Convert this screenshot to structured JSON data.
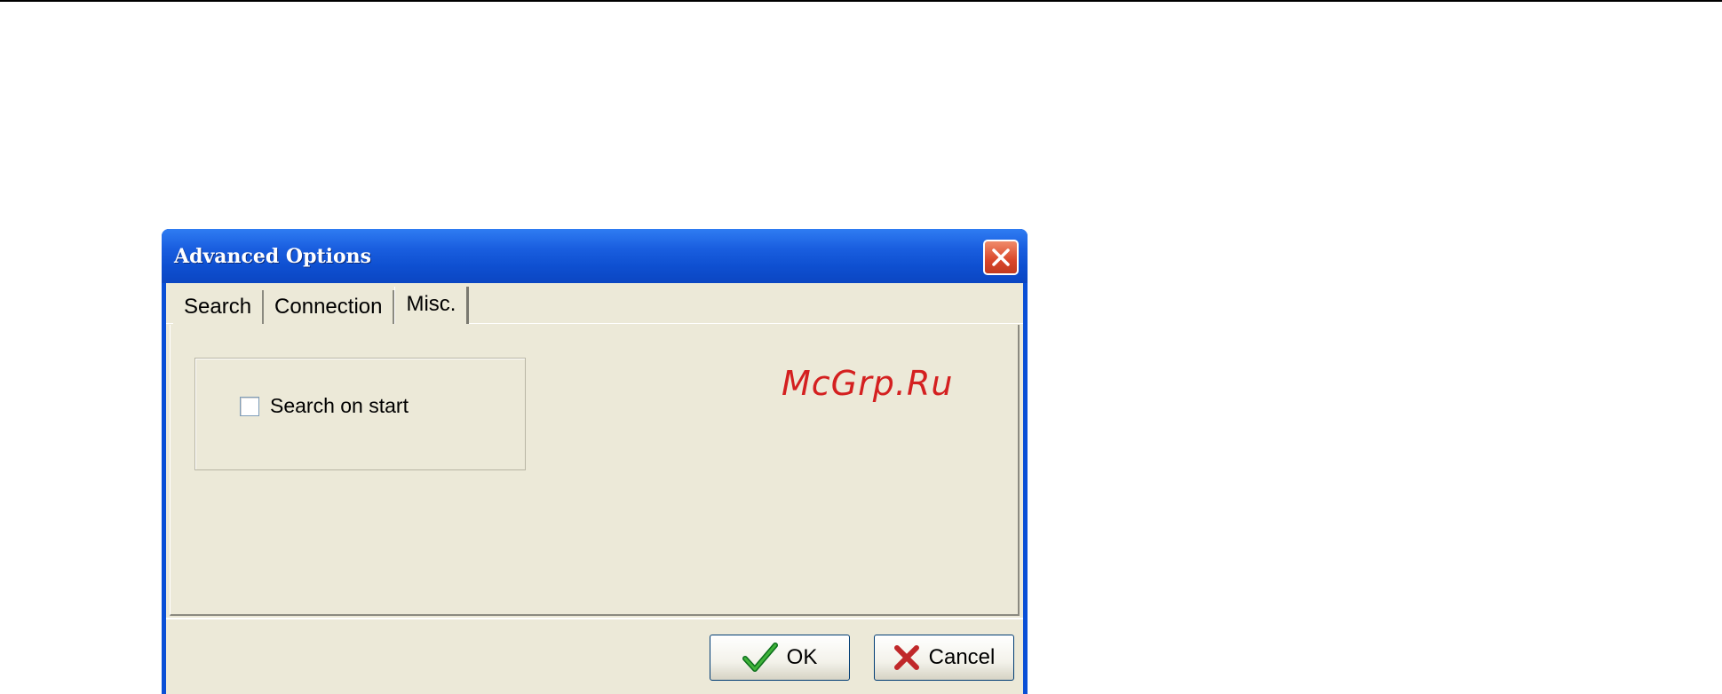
{
  "dialog": {
    "title": "Advanced Options",
    "tabs": [
      {
        "label": "Search"
      },
      {
        "label": "Connection"
      },
      {
        "label": "Misc."
      }
    ],
    "active_tab": "Misc.",
    "misc": {
      "search_on_start": {
        "label": "Search on start",
        "checked": false
      }
    },
    "buttons": {
      "ok_label": "OK",
      "cancel_label": "Cancel"
    },
    "icons": {
      "close": "close-icon",
      "ok": "checkmark-icon",
      "cancel": "x-icon"
    }
  },
  "watermark": "McGrp.Ru",
  "colors": {
    "titlebar": "#0a4fd6",
    "client": "#ece9d8",
    "close_button": "#d9462a",
    "watermark": "#d42020"
  }
}
